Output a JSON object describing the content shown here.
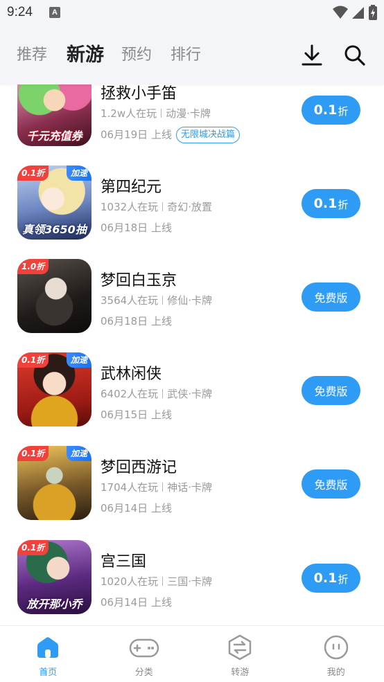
{
  "status_bar": {
    "time": "9:24",
    "notification_letter": "A"
  },
  "header": {
    "tabs": [
      {
        "label": "推荐"
      },
      {
        "label": "新游"
      },
      {
        "label": "预约"
      },
      {
        "label": "排行"
      }
    ],
    "active_tab": "新游"
  },
  "games": [
    {
      "title": "拯救小手笛",
      "players": "1.2w人在玩",
      "genre": "动漫·卡牌",
      "date": "06月19日 上线",
      "event_badge": "无限城决战篇",
      "discount_tag": "",
      "speed_tag": "",
      "icon_caption": "千元充值券",
      "action": {
        "num": "0.1",
        "unit": "折",
        "free": ""
      }
    },
    {
      "title": "第四纪元",
      "players": "1032人在玩",
      "genre": "奇幻·放置",
      "date": "06月18日 上线",
      "event_badge": "",
      "discount_tag": "0.1折",
      "speed_tag": "加速",
      "icon_caption": "真领3650抽",
      "action": {
        "num": "0.1",
        "unit": "折",
        "free": ""
      }
    },
    {
      "title": "梦回白玉京",
      "players": "3564人在玩",
      "genre": "修仙·卡牌",
      "date": "06月18日 上线",
      "event_badge": "",
      "discount_tag": "1.0折",
      "speed_tag": "",
      "icon_caption": "",
      "action": {
        "num": "",
        "unit": "",
        "free": "免费版"
      }
    },
    {
      "title": "武林闲侠",
      "players": "6402人在玩",
      "genre": "武侠·卡牌",
      "date": "06月15日 上线",
      "event_badge": "",
      "discount_tag": "0.1折",
      "speed_tag": "加速",
      "icon_caption": "",
      "action": {
        "num": "",
        "unit": "",
        "free": "免费版"
      }
    },
    {
      "title": "梦回西游记",
      "players": "1704人在玩",
      "genre": "神话·卡牌",
      "date": "06月14日 上线",
      "event_badge": "",
      "discount_tag": "0.1折",
      "speed_tag": "加速",
      "icon_caption": "",
      "action": {
        "num": "",
        "unit": "",
        "free": "免费版"
      }
    },
    {
      "title": "宫三国",
      "players": "1020人在玩",
      "genre": "三国·卡牌",
      "date": "06月14日 上线",
      "event_badge": "",
      "discount_tag": "0.1折",
      "speed_tag": "",
      "icon_caption": "放开那小乔",
      "action": {
        "num": "0.1",
        "unit": "折",
        "free": ""
      }
    }
  ],
  "bottom_nav": [
    {
      "label": "首页",
      "icon": "home-icon"
    },
    {
      "label": "分类",
      "icon": "gamepad-icon"
    },
    {
      "label": "转游",
      "icon": "transfer-icon"
    },
    {
      "label": "我的",
      "icon": "profile-icon"
    }
  ],
  "colors": {
    "accent": "#2e9bf5",
    "discount_tag": "#f0413c",
    "speed_tag": "#1a73f0"
  }
}
